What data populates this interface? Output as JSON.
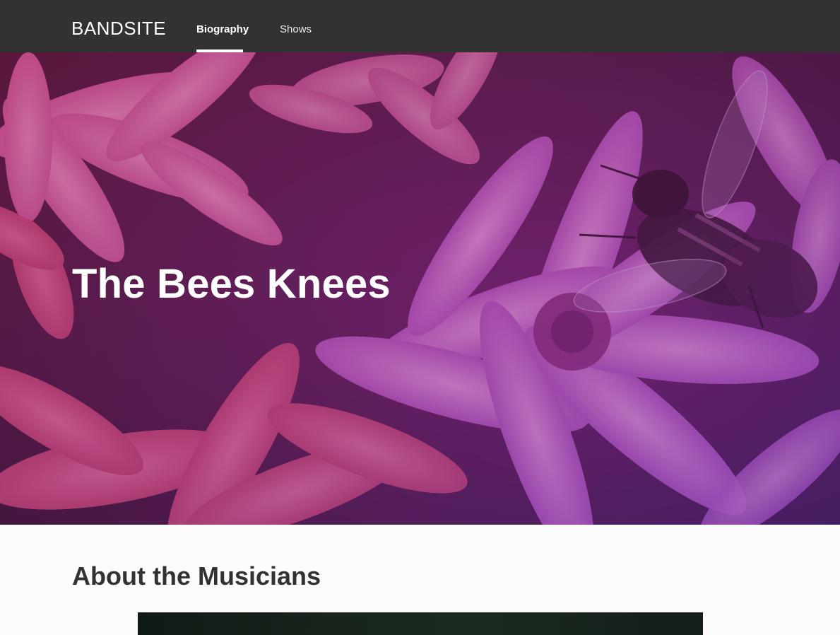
{
  "header": {
    "logo": "BANDSITE",
    "nav": [
      {
        "label": "Biography",
        "active": true
      },
      {
        "label": "Shows",
        "active": false
      }
    ]
  },
  "hero": {
    "title": "The Bees Knees",
    "image": "purple-flowers-with-bee"
  },
  "about": {
    "heading": "About the Musicians",
    "image": "band-photo"
  },
  "colors": {
    "header_bg": "#323232",
    "hero_overlay": "#a0308f",
    "page_bg": "#fbfbfb",
    "text_dark": "#323232"
  }
}
